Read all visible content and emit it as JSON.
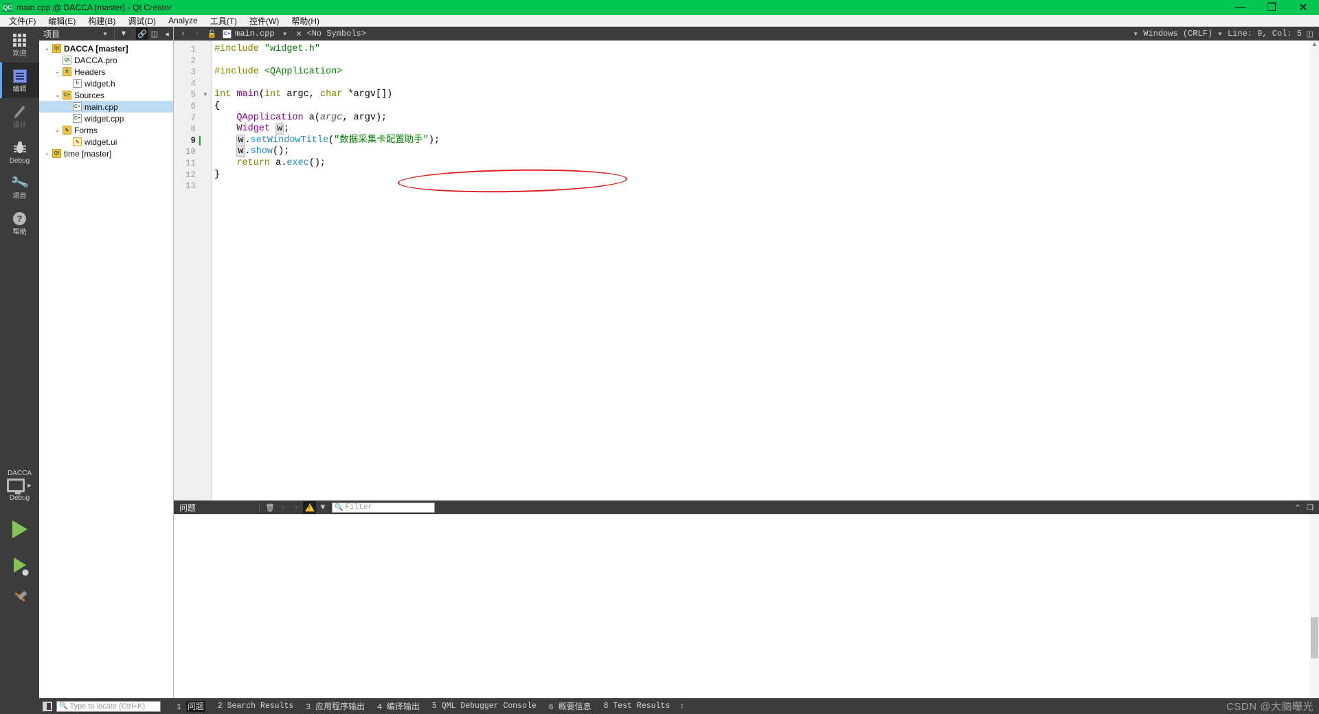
{
  "window": {
    "title": "main.cpp @ DACCA [master] - Qt Creator",
    "logo": "QC",
    "controls": {
      "minimize": "—",
      "maximize": "❐",
      "close": "✕"
    },
    "titlebar_color": "#00c853"
  },
  "menubar": {
    "items": [
      {
        "label": "文件(F)"
      },
      {
        "label": "编辑(E)"
      },
      {
        "label": "构建(B)"
      },
      {
        "label": "调试(D)"
      },
      {
        "label": "Analyze"
      },
      {
        "label": "工具(T)"
      },
      {
        "label": "控件(W)"
      },
      {
        "label": "帮助(H)"
      }
    ]
  },
  "modebar": {
    "items": [
      {
        "label": "欢迎",
        "icon": "grid-icon",
        "state": "normal"
      },
      {
        "label": "编辑",
        "icon": "edit-icon",
        "state": "active"
      },
      {
        "label": "设计",
        "icon": "pencil-icon",
        "state": "disabled"
      },
      {
        "label": "Debug",
        "icon": "bug-icon",
        "state": "normal"
      },
      {
        "label": "项目",
        "icon": "wrench-icon",
        "state": "normal"
      },
      {
        "label": "帮助",
        "icon": "question-icon",
        "state": "normal"
      }
    ]
  },
  "runbar": {
    "kit_name": "DACCA",
    "build_config": "Debug",
    "run_button": "run-button",
    "debug_button": "debug-button",
    "build_button": "build-button"
  },
  "project_pane": {
    "header": {
      "combo_label": "项目",
      "buttons": [
        "filter-icon",
        "link-icon",
        "split-icon",
        "close-sidebar-icon"
      ]
    },
    "tree": [
      {
        "indent": 0,
        "twisty": "⌄",
        "icon": "qt-project-icon",
        "label": "DACCA [master]",
        "bold": true,
        "selected": false,
        "icon_text": "Qt"
      },
      {
        "indent": 1,
        "twisty": "",
        "icon": "pro-file-icon",
        "label": "DACCA.pro",
        "bold": false,
        "selected": false,
        "icon_text": "Qt"
      },
      {
        "indent": 1,
        "twisty": "⌄",
        "icon": "folder-icon",
        "label": "Headers",
        "bold": false,
        "selected": false,
        "icon_text": "h"
      },
      {
        "indent": 2,
        "twisty": "",
        "icon": "header-file-icon",
        "label": "widget.h",
        "bold": false,
        "selected": false,
        "icon_text": "h"
      },
      {
        "indent": 1,
        "twisty": "⌄",
        "icon": "folder-icon",
        "label": "Sources",
        "bold": false,
        "selected": false,
        "icon_text": "C+"
      },
      {
        "indent": 2,
        "twisty": "",
        "icon": "cpp-file-icon",
        "label": "main.cpp",
        "bold": false,
        "selected": true,
        "icon_text": "C+"
      },
      {
        "indent": 2,
        "twisty": "",
        "icon": "cpp-file-icon",
        "label": "widget.cpp",
        "bold": false,
        "selected": false,
        "icon_text": "C+"
      },
      {
        "indent": 1,
        "twisty": "⌄",
        "icon": "folder-icon",
        "label": "Forms",
        "bold": false,
        "selected": false,
        "icon_text": "✎"
      },
      {
        "indent": 2,
        "twisty": "",
        "icon": "ui-file-icon",
        "label": "widget.ui",
        "bold": false,
        "selected": false,
        "icon_text": "✎"
      },
      {
        "indent": 0,
        "twisty": "›",
        "icon": "qt-project-icon",
        "label": "time [master]",
        "bold": false,
        "selected": false,
        "icon_text": "Qt"
      }
    ]
  },
  "editor_toolbar": {
    "back_label": "‹",
    "forward_label": "›",
    "lock_label": "lock-icon",
    "file_name": "main.cpp",
    "symbol_selector": "<No Symbols>",
    "line_ending": "Windows (CRLF)",
    "cursor_position": "Line: 9, Col: 5",
    "split_label": "split-icon"
  },
  "code": {
    "cursor_line": 9,
    "line_numbers": [
      1,
      2,
      3,
      4,
      5,
      6,
      7,
      8,
      9,
      10,
      11,
      12,
      13
    ],
    "fold_line": 5,
    "lines": [
      {
        "n": 1,
        "tokens": [
          {
            "t": "#include ",
            "c": "k-pre"
          },
          {
            "t": "\"widget.h\"",
            "c": "k-str"
          }
        ]
      },
      {
        "n": 2,
        "tokens": []
      },
      {
        "n": 3,
        "tokens": [
          {
            "t": "#include ",
            "c": "k-pre"
          },
          {
            "t": "<QApplication>",
            "c": "k-str"
          }
        ]
      },
      {
        "n": 4,
        "tokens": []
      },
      {
        "n": 5,
        "tokens": [
          {
            "t": "int",
            "c": "k-type"
          },
          {
            "t": " ",
            "c": "k-var"
          },
          {
            "t": "main",
            "c": "k-fn"
          },
          {
            "t": "(",
            "c": "k-punct"
          },
          {
            "t": "int",
            "c": "k-type"
          },
          {
            "t": " argc, ",
            "c": "k-var"
          },
          {
            "t": "char",
            "c": "k-type"
          },
          {
            "t": " *argv[])",
            "c": "k-var"
          }
        ]
      },
      {
        "n": 6,
        "tokens": [
          {
            "t": "{",
            "c": "k-punct"
          }
        ]
      },
      {
        "n": 7,
        "tokens": [
          {
            "t": "    ",
            "c": "k-var"
          },
          {
            "t": "QApplication",
            "c": "k-fn"
          },
          {
            "t": " a(",
            "c": "k-var"
          },
          {
            "t": "argc",
            "c": "k-param"
          },
          {
            "t": ", argv);",
            "c": "k-var"
          }
        ]
      },
      {
        "n": 8,
        "tokens": [
          {
            "t": "    ",
            "c": "k-var"
          },
          {
            "t": "Widget",
            "c": "k-fn"
          },
          {
            "t": " ",
            "c": "k-var"
          },
          {
            "t": "w",
            "c": "varbox"
          },
          {
            "t": ";",
            "c": "k-var"
          }
        ]
      },
      {
        "n": 9,
        "tokens": [
          {
            "t": "    ",
            "c": "k-var"
          },
          {
            "t": "w",
            "c": "varbox"
          },
          {
            "t": ".",
            "c": "k-var"
          },
          {
            "t": "setWindowTitle",
            "c": "k-call"
          },
          {
            "t": "(",
            "c": "k-var"
          },
          {
            "t": "\"数据采集卡配置助手\"",
            "c": "k-str"
          },
          {
            "t": ");",
            "c": "k-var"
          }
        ]
      },
      {
        "n": 10,
        "tokens": [
          {
            "t": "    ",
            "c": "k-var"
          },
          {
            "t": "w",
            "c": "varbox"
          },
          {
            "t": ".",
            "c": "k-var"
          },
          {
            "t": "show",
            "c": "k-call"
          },
          {
            "t": "();",
            "c": "k-var"
          }
        ]
      },
      {
        "n": 11,
        "tokens": [
          {
            "t": "    ",
            "c": "k-var"
          },
          {
            "t": "return",
            "c": "k-type"
          },
          {
            "t": " a.",
            "c": "k-var"
          },
          {
            "t": "exec",
            "c": "k-call"
          },
          {
            "t": "();",
            "c": "k-var"
          }
        ]
      },
      {
        "n": 12,
        "tokens": [
          {
            "t": "}",
            "c": "k-punct"
          }
        ]
      },
      {
        "n": 13,
        "tokens": []
      }
    ],
    "annotation": {
      "shape": "red-ellipse",
      "color": "#e02020",
      "targets_line": 9
    }
  },
  "issues_panel": {
    "title": "问题",
    "toolbar": [
      "clear-icon",
      "prev-icon",
      "next-icon",
      "warning-filter-icon",
      "filter-icon"
    ],
    "filter_placeholder": "Filter",
    "collapse_label": "⌃",
    "maximize_label": "❐"
  },
  "statusbar": {
    "locator_placeholder": "Type to locate (Ctrl+K)",
    "output_tabs": [
      {
        "num": "1",
        "label": "问题",
        "selected": true,
        "cjk": true
      },
      {
        "num": "2",
        "label": "Search Results",
        "selected": false,
        "cjk": false
      },
      {
        "num": "3",
        "label": "应用程序输出",
        "selected": false,
        "cjk": true
      },
      {
        "num": "4",
        "label": "编译输出",
        "selected": false,
        "cjk": true
      },
      {
        "num": "5",
        "label": "QML Debugger Console",
        "selected": false,
        "cjk": false
      },
      {
        "num": "6",
        "label": "概要信息",
        "selected": false,
        "cjk": true
      },
      {
        "num": "8",
        "label": "Test Results",
        "selected": false,
        "cjk": false
      }
    ],
    "watermark": "CSDN @大脑曝光"
  }
}
